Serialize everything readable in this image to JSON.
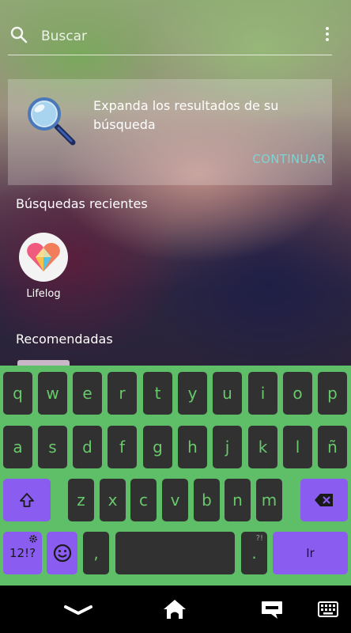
{
  "search": {
    "placeholder": "Buscar"
  },
  "card": {
    "text": "Expanda los resultados de su búsqueda",
    "button_label": "CONTINUAR"
  },
  "recent": {
    "title": "Búsquedas recientes",
    "apps": [
      {
        "label": "Lifelog"
      }
    ]
  },
  "recommended": {
    "title": "Recomendadas"
  },
  "keyboard": {
    "row1": [
      "q",
      "w",
      "e",
      "r",
      "t",
      "y",
      "u",
      "i",
      "o",
      "p"
    ],
    "row2": [
      "a",
      "s",
      "d",
      "f",
      "g",
      "h",
      "j",
      "k",
      "l",
      "ñ"
    ],
    "row3": [
      "z",
      "x",
      "c",
      "v",
      "b",
      "n",
      "m"
    ],
    "symbols_label": "12!?",
    "comma": ",",
    "period": ".",
    "period_hint": "?!",
    "enter_label": "Ir"
  },
  "colors": {
    "keyboard_bg": "#5fbe68",
    "key_bg": "#313131",
    "key_text": "#68c96a",
    "accent_purple": "#8a5cf0",
    "link": "#7fd3d3"
  },
  "icons": {
    "search": "search-icon",
    "menu": "kebab-menu-icon",
    "card": "magnifier-icon",
    "app": "lifelog-heart-icon",
    "shift": "shift-icon",
    "backspace": "backspace-icon",
    "settings": "gear-icon",
    "emoji": "emoji-icon",
    "nav_back": "chevron-down-icon",
    "nav_home": "home-icon",
    "nav_recents": "chat-icon",
    "nav_keyboard": "keyboard-icon"
  }
}
